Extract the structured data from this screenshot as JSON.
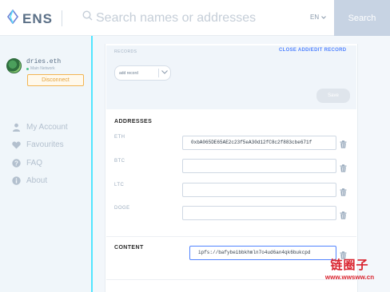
{
  "header": {
    "logo_text": "ENS",
    "search_placeholder": "Search names or addresses",
    "language": "EN",
    "search_button": "Search"
  },
  "account": {
    "name": "dries.eth",
    "network": "Main Network",
    "disconnect_label": "Disconnect"
  },
  "nav": [
    {
      "label": "My Account",
      "icon": "user-icon"
    },
    {
      "label": "Favourites",
      "icon": "heart-icon"
    },
    {
      "label": "FAQ",
      "icon": "question-icon"
    },
    {
      "label": "About",
      "icon": "info-icon"
    }
  ],
  "records": {
    "label": "RECORDS",
    "close_link": "CLOSE ADD/EDIT RECORD",
    "select_value": "add record",
    "save_label": "Save"
  },
  "addresses": {
    "title": "ADDRESSES",
    "items": [
      {
        "coin": "ETH",
        "value": "0xbA065DE65AE2c23f5eA30d12fC8c2f883cbe671f"
      },
      {
        "coin": "BTC",
        "value": ""
      },
      {
        "coin": "LTC",
        "value": ""
      },
      {
        "coin": "DOGE",
        "value": ""
      }
    ]
  },
  "content": {
    "title": "CONTENT",
    "value": "ipfs://bafybeibbkhmln7o4ud6an4qk6bukcpd"
  },
  "watermark": {
    "chinese": "链圈子",
    "url": "www.wwsww.cn"
  },
  "colors": {
    "accent_cyan": "#52e5ff",
    "link_blue": "#5284ff",
    "disconnect_orange": "#f2b553",
    "search_button_bg": "#c7d3e3",
    "watermark_red": "#d9232e"
  }
}
